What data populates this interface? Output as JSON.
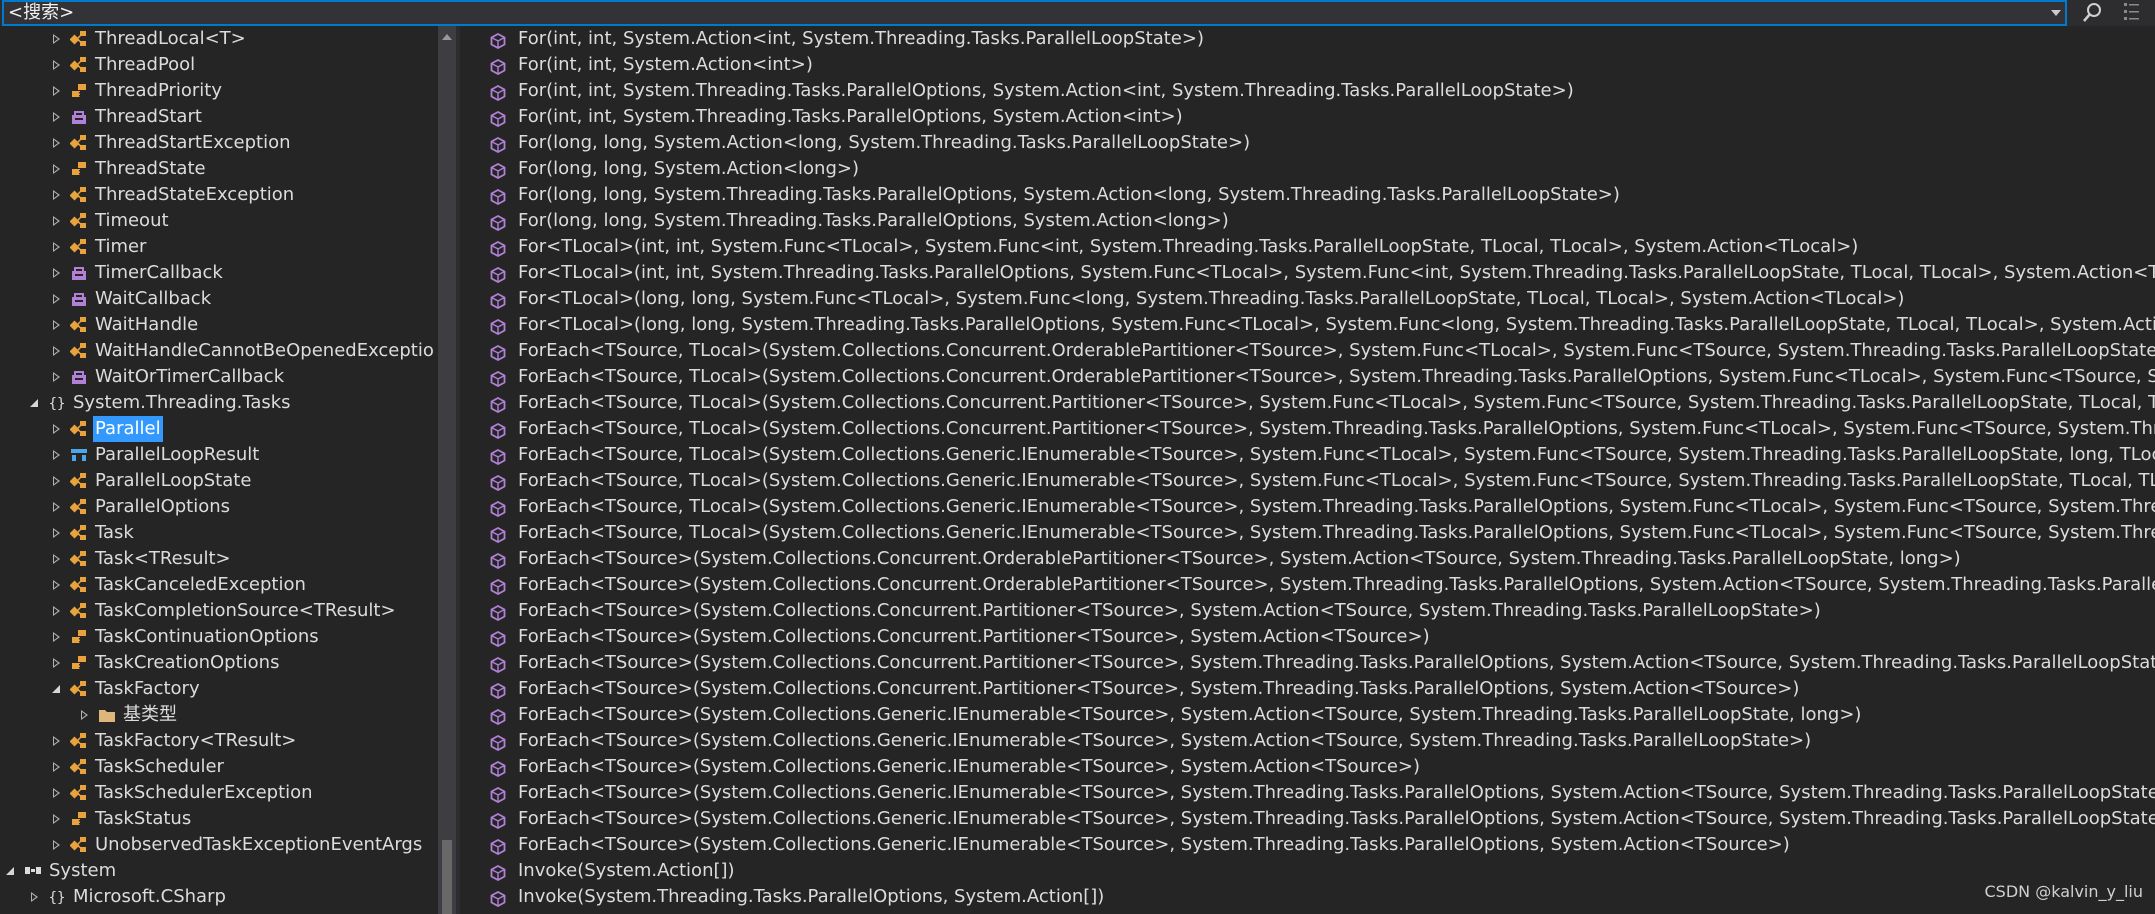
{
  "search": {
    "value": "<搜索>"
  },
  "watermark": "CSDN @kalvin_y_liu",
  "tree": [
    {
      "label": "ThreadLocal<T>",
      "icon": "class-icon",
      "level": 2,
      "expander": "closed"
    },
    {
      "label": "ThreadPool",
      "icon": "class-icon",
      "level": 2,
      "expander": "closed"
    },
    {
      "label": "ThreadPriority",
      "icon": "enum-icon",
      "level": 2,
      "expander": "closed"
    },
    {
      "label": "ThreadStart",
      "icon": "delegate-icon",
      "level": 2,
      "expander": "closed"
    },
    {
      "label": "ThreadStartException",
      "icon": "class-icon",
      "level": 2,
      "expander": "closed"
    },
    {
      "label": "ThreadState",
      "icon": "enum-icon",
      "level": 2,
      "expander": "closed"
    },
    {
      "label": "ThreadStateException",
      "icon": "class-icon",
      "level": 2,
      "expander": "closed"
    },
    {
      "label": "Timeout",
      "icon": "class-icon",
      "level": 2,
      "expander": "closed"
    },
    {
      "label": "Timer",
      "icon": "class-icon",
      "level": 2,
      "expander": "closed"
    },
    {
      "label": "TimerCallback",
      "icon": "delegate-icon",
      "level": 2,
      "expander": "closed"
    },
    {
      "label": "WaitCallback",
      "icon": "delegate-icon",
      "level": 2,
      "expander": "closed"
    },
    {
      "label": "WaitHandle",
      "icon": "class-icon",
      "level": 2,
      "expander": "closed"
    },
    {
      "label": "WaitHandleCannotBeOpenedExceptio",
      "icon": "class-icon",
      "level": 2,
      "expander": "closed"
    },
    {
      "label": "WaitOrTimerCallback",
      "icon": "delegate-icon",
      "level": 2,
      "expander": "closed"
    },
    {
      "label": "System.Threading.Tasks",
      "icon": "namespace-icon",
      "level": 1,
      "expander": "open"
    },
    {
      "label": "Parallel",
      "icon": "class-icon",
      "level": 2,
      "expander": "closed",
      "selected": true
    },
    {
      "label": "ParallelLoopResult",
      "icon": "struct-icon",
      "level": 2,
      "expander": "closed"
    },
    {
      "label": "ParallelLoopState",
      "icon": "class-icon",
      "level": 2,
      "expander": "closed"
    },
    {
      "label": "ParallelOptions",
      "icon": "class-icon",
      "level": 2,
      "expander": "closed"
    },
    {
      "label": "Task",
      "icon": "class-icon",
      "level": 2,
      "expander": "closed"
    },
    {
      "label": "Task<TResult>",
      "icon": "class-icon",
      "level": 2,
      "expander": "closed"
    },
    {
      "label": "TaskCanceledException",
      "icon": "class-icon",
      "level": 2,
      "expander": "closed"
    },
    {
      "label": "TaskCompletionSource<TResult>",
      "icon": "class-icon",
      "level": 2,
      "expander": "closed"
    },
    {
      "label": "TaskContinuationOptions",
      "icon": "enum-icon",
      "level": 2,
      "expander": "closed"
    },
    {
      "label": "TaskCreationOptions",
      "icon": "enum-icon",
      "level": 2,
      "expander": "closed"
    },
    {
      "label": "TaskFactory",
      "icon": "class-icon",
      "level": 2,
      "expander": "open"
    },
    {
      "label": "基类型",
      "icon": "folder-icon",
      "level": 3,
      "expander": "closed"
    },
    {
      "label": "TaskFactory<TResult>",
      "icon": "class-icon",
      "level": 2,
      "expander": "closed"
    },
    {
      "label": "TaskScheduler",
      "icon": "class-icon",
      "level": 2,
      "expander": "closed"
    },
    {
      "label": "TaskSchedulerException",
      "icon": "class-icon",
      "level": 2,
      "expander": "closed"
    },
    {
      "label": "TaskStatus",
      "icon": "enum-icon",
      "level": 2,
      "expander": "closed"
    },
    {
      "label": "UnobservedTaskExceptionEventArgs",
      "icon": "class-icon",
      "level": 2,
      "expander": "closed"
    },
    {
      "label": "System",
      "icon": "assembly-icon",
      "level": 0,
      "expander": "open"
    },
    {
      "label": "Microsoft.CSharp",
      "icon": "namespace-icon",
      "level": 1,
      "expander": "closed"
    }
  ],
  "members": [
    "For(int, int, System.Action<int, System.Threading.Tasks.ParallelLoopState>)",
    "For(int, int, System.Action<int>)",
    "For(int, int, System.Threading.Tasks.ParallelOptions, System.Action<int, System.Threading.Tasks.ParallelLoopState>)",
    "For(int, int, System.Threading.Tasks.ParallelOptions, System.Action<int>)",
    "For(long, long, System.Action<long, System.Threading.Tasks.ParallelLoopState>)",
    "For(long, long, System.Action<long>)",
    "For(long, long, System.Threading.Tasks.ParallelOptions, System.Action<long, System.Threading.Tasks.ParallelLoopState>)",
    "For(long, long, System.Threading.Tasks.ParallelOptions, System.Action<long>)",
    "For<TLocal>(int, int, System.Func<TLocal>, System.Func<int, System.Threading.Tasks.ParallelLoopState, TLocal, TLocal>, System.Action<TLocal>)",
    "For<TLocal>(int, int, System.Threading.Tasks.ParallelOptions, System.Func<TLocal>, System.Func<int, System.Threading.Tasks.ParallelLoopState, TLocal, TLocal>, System.Action<TLocal>)",
    "For<TLocal>(long, long, System.Func<TLocal>, System.Func<long, System.Threading.Tasks.ParallelLoopState, TLocal, TLocal>, System.Action<TLocal>)",
    "For<TLocal>(long, long, System.Threading.Tasks.ParallelOptions, System.Func<TLocal>, System.Func<long, System.Threading.Tasks.ParallelLoopState, TLocal, TLocal>, System.Action<TLocal>)",
    "ForEach<TSource, TLocal>(System.Collections.Concurrent.OrderablePartitioner<TSource>, System.Func<TLocal>, System.Func<TSource, System.Threading.Tasks.ParallelLoopState, long, TLocal, TLocal>, System.Action<TLocal>)",
    "ForEach<TSource, TLocal>(System.Collections.Concurrent.OrderablePartitioner<TSource>, System.Threading.Tasks.ParallelOptions, System.Func<TLocal>, System.Func<TSource, System.Threading.Tasks.ParallelLoopState, long, TLocal, TLocal>, System.Action<TLocal>)",
    "ForEach<TSource, TLocal>(System.Collections.Concurrent.Partitioner<TSource>, System.Func<TLocal>, System.Func<TSource, System.Threading.Tasks.ParallelLoopState, TLocal, TLocal>, System.Action<TLocal>)",
    "ForEach<TSource, TLocal>(System.Collections.Concurrent.Partitioner<TSource>, System.Threading.Tasks.ParallelOptions, System.Func<TLocal>, System.Func<TSource, System.Threading.Tasks.ParallelLoopState, TLocal, TLocal>, System.Action<TLocal>)",
    "ForEach<TSource, TLocal>(System.Collections.Generic.IEnumerable<TSource>, System.Func<TLocal>, System.Func<TSource, System.Threading.Tasks.ParallelLoopState, long, TLocal, TLocal>, System.Action<TLocal>)",
    "ForEach<TSource, TLocal>(System.Collections.Generic.IEnumerable<TSource>, System.Func<TLocal>, System.Func<TSource, System.Threading.Tasks.ParallelLoopState, TLocal, TLocal>, System.Action<TLocal>)",
    "ForEach<TSource, TLocal>(System.Collections.Generic.IEnumerable<TSource>, System.Threading.Tasks.ParallelOptions, System.Func<TLocal>, System.Func<TSource, System.Threading.Tasks.ParallelLoopState, long, TLocal, TLocal>, System.Action<TLocal>)",
    "ForEach<TSource, TLocal>(System.Collections.Generic.IEnumerable<TSource>, System.Threading.Tasks.ParallelOptions, System.Func<TLocal>, System.Func<TSource, System.Threading.Tasks.ParallelLoopState, TLocal, TLocal>, System.Action<TLocal>)",
    "ForEach<TSource>(System.Collections.Concurrent.OrderablePartitioner<TSource>, System.Action<TSource, System.Threading.Tasks.ParallelLoopState, long>)",
    "ForEach<TSource>(System.Collections.Concurrent.OrderablePartitioner<TSource>, System.Threading.Tasks.ParallelOptions, System.Action<TSource, System.Threading.Tasks.ParallelLoopState, long>)",
    "ForEach<TSource>(System.Collections.Concurrent.Partitioner<TSource>, System.Action<TSource, System.Threading.Tasks.ParallelLoopState>)",
    "ForEach<TSource>(System.Collections.Concurrent.Partitioner<TSource>, System.Action<TSource>)",
    "ForEach<TSource>(System.Collections.Concurrent.Partitioner<TSource>, System.Threading.Tasks.ParallelOptions, System.Action<TSource, System.Threading.Tasks.ParallelLoopState>)",
    "ForEach<TSource>(System.Collections.Concurrent.Partitioner<TSource>, System.Threading.Tasks.ParallelOptions, System.Action<TSource>)",
    "ForEach<TSource>(System.Collections.Generic.IEnumerable<TSource>, System.Action<TSource, System.Threading.Tasks.ParallelLoopState, long>)",
    "ForEach<TSource>(System.Collections.Generic.IEnumerable<TSource>, System.Action<TSource, System.Threading.Tasks.ParallelLoopState>)",
    "ForEach<TSource>(System.Collections.Generic.IEnumerable<TSource>, System.Action<TSource>)",
    "ForEach<TSource>(System.Collections.Generic.IEnumerable<TSource>, System.Threading.Tasks.ParallelOptions, System.Action<TSource, System.Threading.Tasks.ParallelLoopState, long>)",
    "ForEach<TSource>(System.Collections.Generic.IEnumerable<TSource>, System.Threading.Tasks.ParallelOptions, System.Action<TSource, System.Threading.Tasks.ParallelLoopState>)",
    "ForEach<TSource>(System.Collections.Generic.IEnumerable<TSource>, System.Threading.Tasks.ParallelOptions, System.Action<TSource>)",
    "Invoke(System.Action[])",
    "Invoke(System.Threading.Tasks.ParallelOptions, System.Action[])"
  ],
  "colors": {
    "background": "#252526",
    "selection": "#3399ff",
    "accent": "#007acc",
    "class_icon": "#e8a33d",
    "delegate_icon": "#b180d7",
    "method_icon": "#b180d7",
    "struct_icon": "#4ea6ea"
  }
}
